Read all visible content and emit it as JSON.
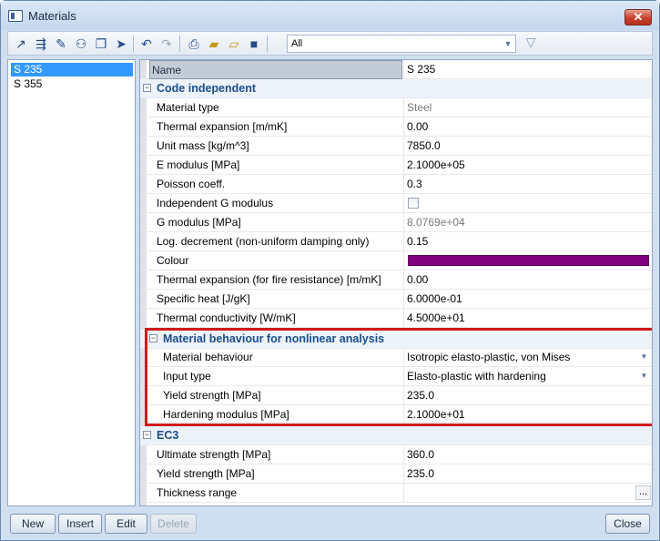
{
  "window": {
    "title": "Materials",
    "close_symbol": "✕"
  },
  "toolbar": {
    "filter_value": "All",
    "buttons": [
      "arrow-up-right-icon",
      "align-icon",
      "edit-pencil-icon",
      "binoculars-icon",
      "copy-icon",
      "cursor-icon",
      "undo-icon",
      "redo-icon",
      "print-icon",
      "open-folder-icon",
      "open-folder-alt-icon",
      "save-icon",
      "funnel-icon"
    ]
  },
  "materials_list": [
    "S 235",
    "S 355"
  ],
  "properties": {
    "name_label": "Name",
    "name_value": "S 235",
    "code_independent": {
      "title": "Code independent",
      "rows": [
        {
          "label": "Material type",
          "value": "Steel"
        },
        {
          "label": "Thermal expansion  [m/mK]",
          "value": "0.00"
        },
        {
          "label": "Unit mass [kg/m^3]",
          "value": "7850.0"
        },
        {
          "label": "E modulus [MPa]",
          "value": "2.1000e+05"
        },
        {
          "label": "Poisson coeff.",
          "value": "0.3"
        },
        {
          "label": "Independent G modulus",
          "value": ""
        },
        {
          "label": "G modulus [MPa]",
          "value": "8.0769e+04"
        },
        {
          "label": "Log. decrement (non-uniform damping only)",
          "value": "0.15"
        },
        {
          "label": "Colour",
          "value": ""
        },
        {
          "label": "Thermal expansion (for fire resistance)  [m/mK]",
          "value": "0.00"
        },
        {
          "label": "Specific heat [J/gK]",
          "value": "6.0000e-01"
        },
        {
          "label": "Thermal conductivity [W/mK]",
          "value": "4.5000e+01"
        }
      ],
      "colour_hex": "#800080"
    },
    "nonlinear": {
      "title": "Material behaviour for nonlinear analysis",
      "rows": [
        {
          "label": "Material behaviour",
          "value": "Isotropic elasto-plastic, von Mises"
        },
        {
          "label": "Input type",
          "value": "Elasto-plastic with hardening"
        },
        {
          "label": "Yield strength [MPa]",
          "value": "235.0"
        },
        {
          "label": "Hardening modulus [MPa]",
          "value": "2.1000e+01"
        }
      ]
    },
    "ec3": {
      "title": "EC3",
      "rows": [
        {
          "label": "Ultimate strength [MPa]",
          "value": "360.0"
        },
        {
          "label": "Yield strength [MPa]",
          "value": "235.0"
        },
        {
          "label": "Thickness range",
          "value": "",
          "button": "..."
        }
      ]
    },
    "collapse_symbol": "⊟"
  },
  "buttons": {
    "new": "New",
    "insert": "Insert",
    "edit": "Edit",
    "delete": "Delete",
    "close": "Close"
  },
  "colors": {
    "highlight": "#d11a1a",
    "selection": "#3399ff",
    "group_title": "#1b4e8c"
  }
}
